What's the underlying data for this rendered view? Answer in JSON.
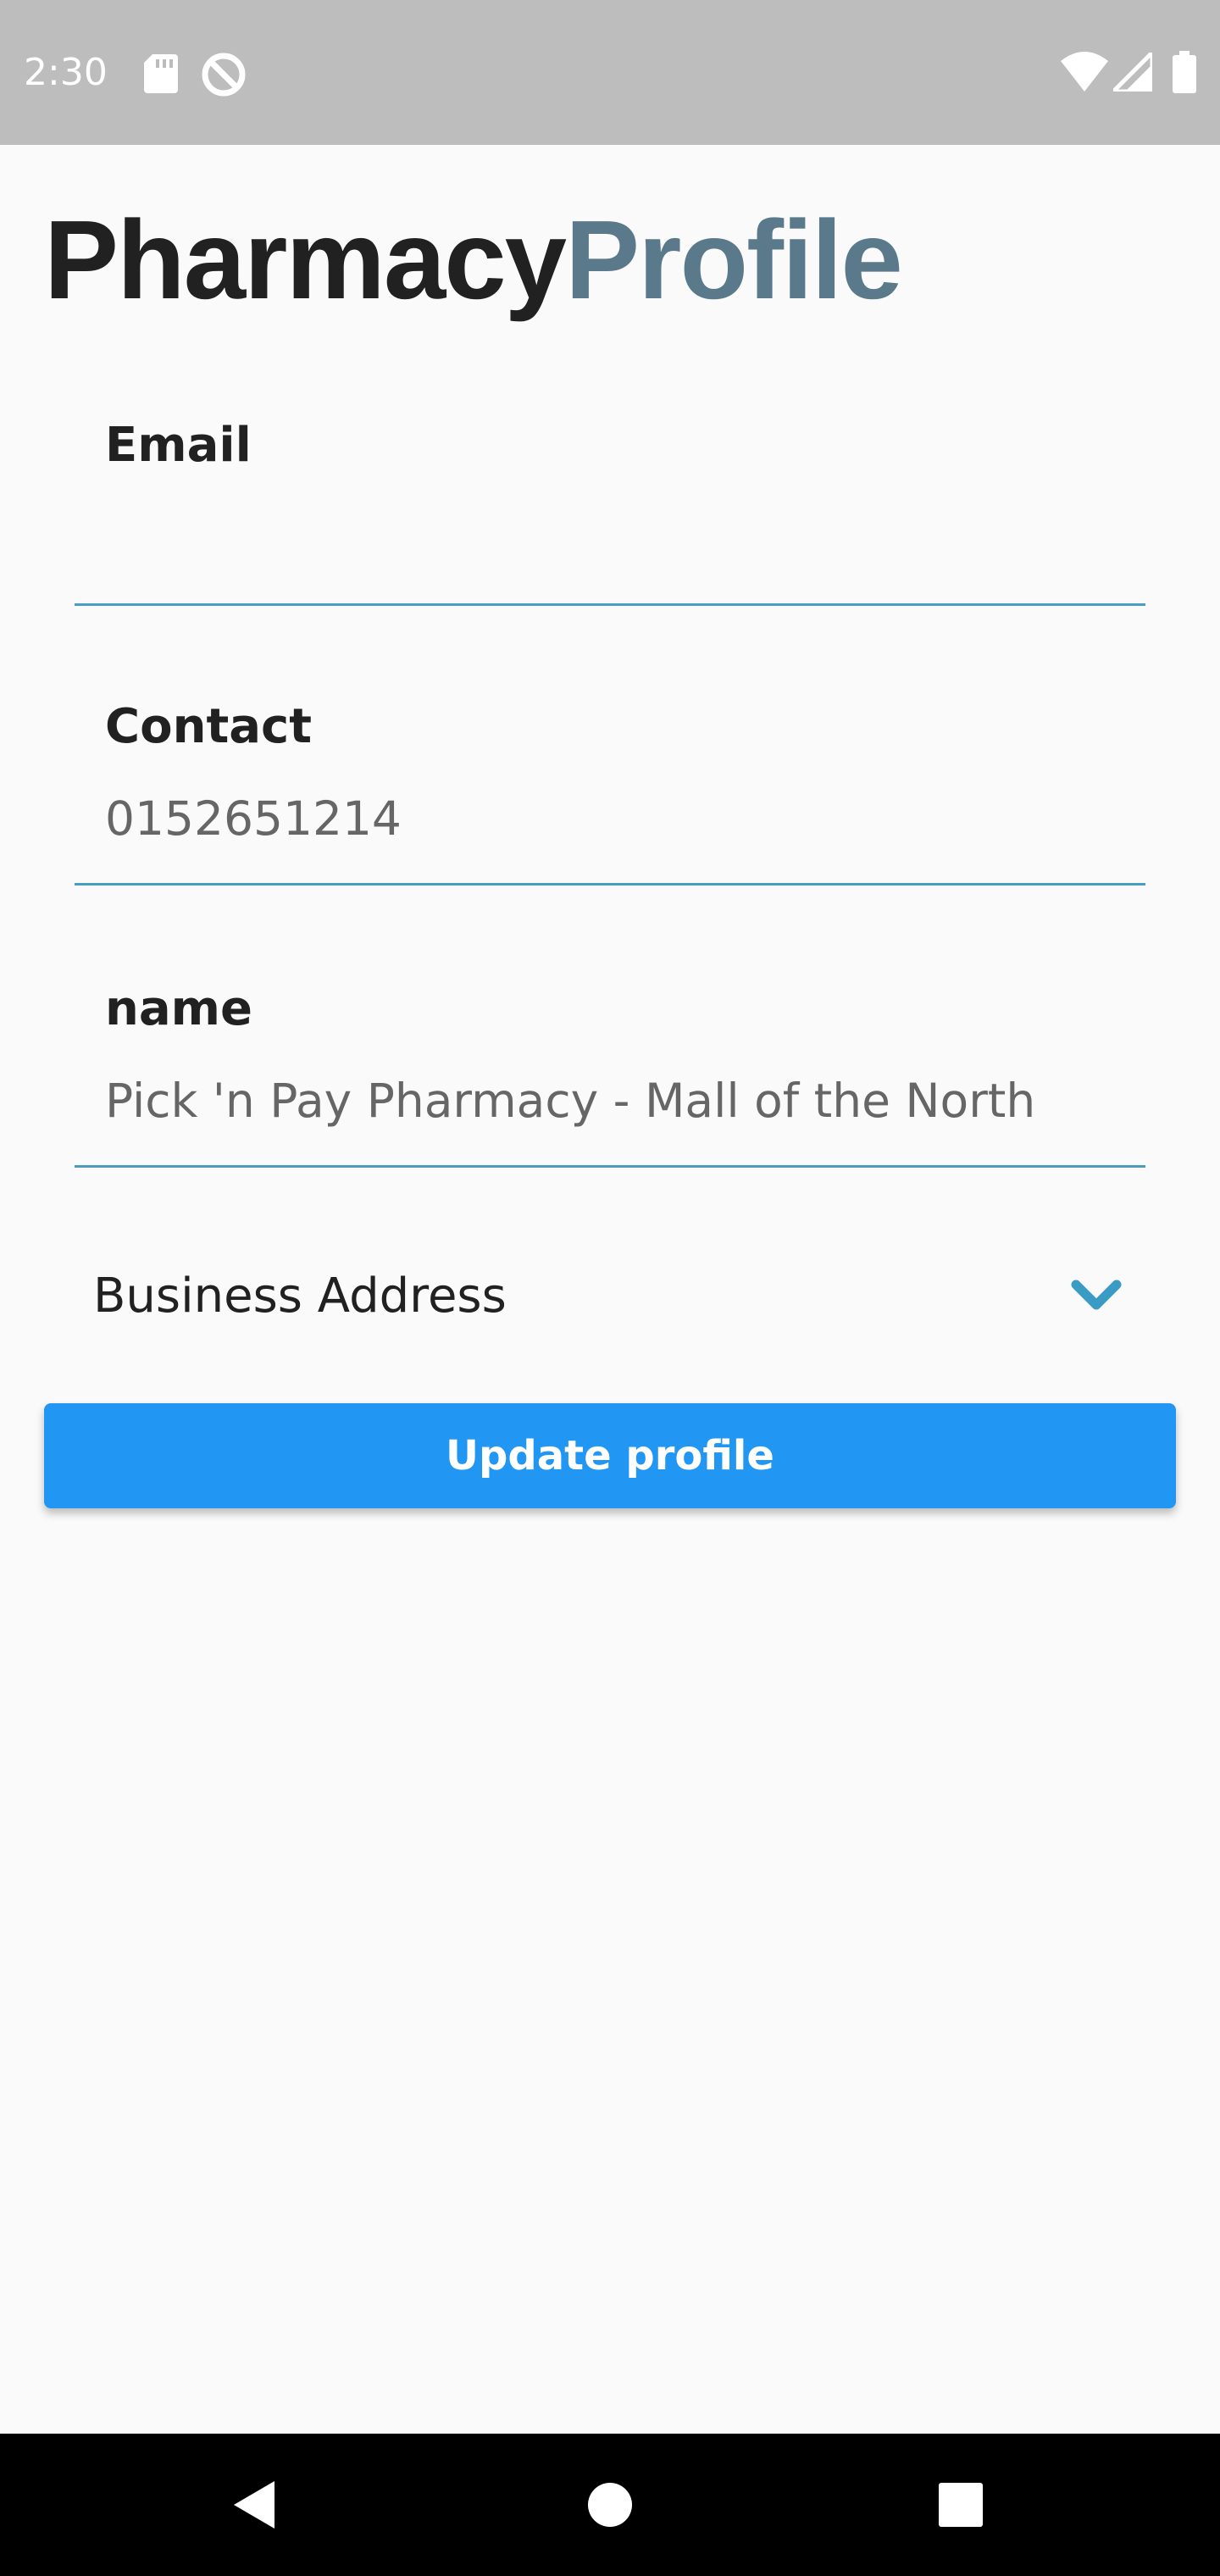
{
  "status_bar": {
    "time": "2:30",
    "icons": [
      "sd-card-icon",
      "sync-disabled-icon",
      "wifi-icon",
      "cell-signal-icon",
      "battery-icon"
    ]
  },
  "header": {
    "title_part1": "Pharmacy",
    "title_part2": "Profile",
    "title_part2_color": "#5a7a8c"
  },
  "form": {
    "email": {
      "label": "Email",
      "value": ""
    },
    "contact": {
      "label": "Contact",
      "value": "0152651214"
    },
    "name": {
      "label": "name",
      "value": "Pick 'n Pay Pharmacy - Mall of the North"
    },
    "business_address": {
      "label": "Business Address",
      "icon": "chevron-down-icon"
    },
    "underline_color": "#4a9cc0"
  },
  "actions": {
    "update_label": "Update profile",
    "update_color": "#2196f3"
  },
  "nav_bar": {
    "buttons": [
      "back-icon",
      "home-icon",
      "recents-icon"
    ]
  }
}
